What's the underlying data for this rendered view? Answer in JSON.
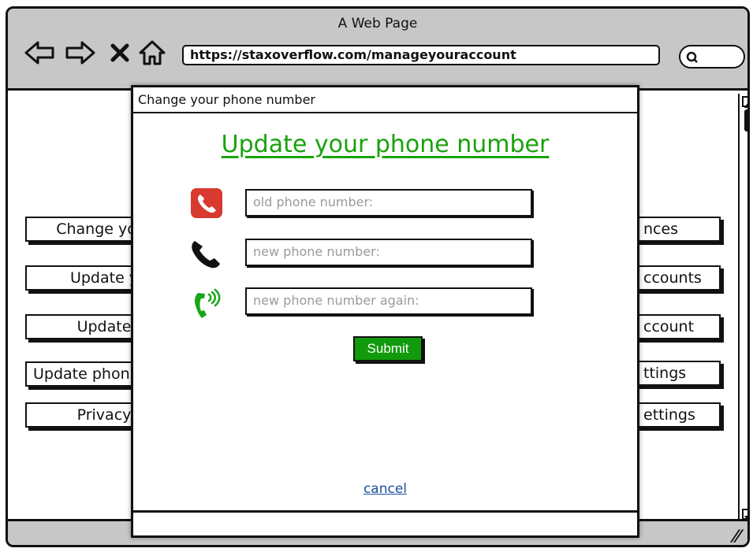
{
  "window": {
    "title": "A Web Page"
  },
  "browser": {
    "url": "https://staxoverflow.com/manageyouraccount",
    "nav": [
      "back-icon",
      "forward-icon",
      "stop-icon",
      "home-icon"
    ],
    "search_icon": "search-icon"
  },
  "page": {
    "left_buttons": [
      "Change your",
      "Update y",
      "Update",
      "Update phon",
      "Privacy"
    ],
    "right_buttons": [
      "nces",
      "ccounts",
      "ccount",
      "ttings",
      "ettings"
    ]
  },
  "modal": {
    "title": "Change your phone number",
    "heading": "Update your phone number",
    "fields": [
      {
        "icon": "phone-red-icon",
        "placeholder": "old phone number:"
      },
      {
        "icon": "phone-icon",
        "placeholder": "new phone number:"
      },
      {
        "icon": "phone-ringing-icon",
        "placeholder": "new phone number again:"
      }
    ],
    "submit_label": "Submit",
    "cancel_label": "cancel"
  },
  "colors": {
    "accent_green": "#18a30a",
    "button_green": "#119b0c",
    "chrome_gray": "#c7c7c7",
    "link_blue": "#1a4f9c",
    "phone_red": "#d93a30"
  }
}
